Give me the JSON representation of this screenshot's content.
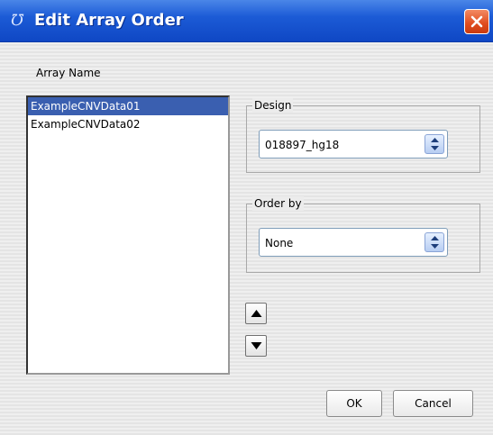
{
  "window": {
    "title": "Edit Array Order",
    "app_icon": "app-glyph-icon"
  },
  "array_list": {
    "label": "Array Name",
    "items": [
      {
        "name": "ExampleCNVData01",
        "selected": true
      },
      {
        "name": "ExampleCNVData02",
        "selected": false
      }
    ]
  },
  "design": {
    "legend": "Design",
    "value": "018897_hg18"
  },
  "order_by": {
    "legend": "Order by",
    "value": "None"
  },
  "buttons": {
    "ok": "OK",
    "cancel": "Cancel"
  },
  "colors": {
    "titlebar": "#1c5bd6",
    "close": "#e04c1e",
    "selection": "#3a5fb0"
  }
}
